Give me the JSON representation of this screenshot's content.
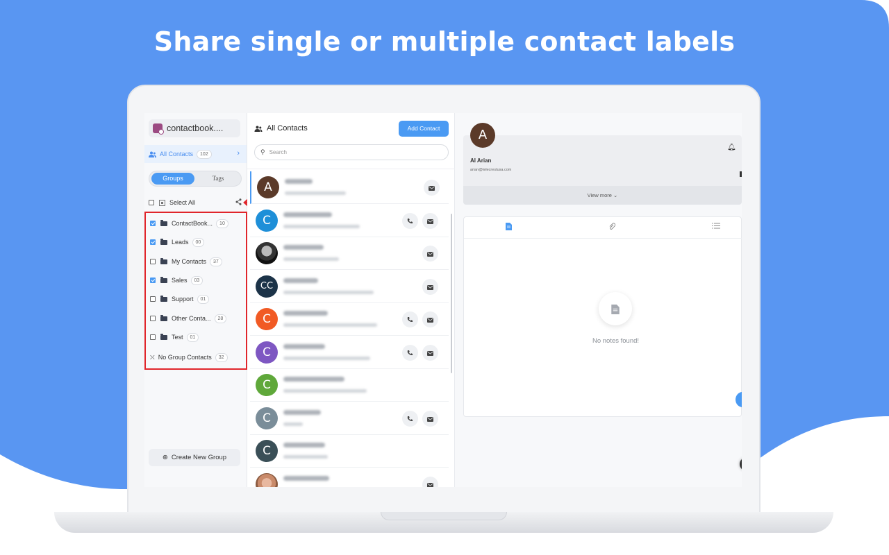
{
  "headline": "Share single or multiple contact labels",
  "colors": {
    "background_blue": "#5996f2",
    "accent": "#4a9af3",
    "highlight_red": "#e0252b"
  },
  "sidebar": {
    "brand": "contactbook....",
    "all_contacts": {
      "label": "All Contacts",
      "count": "102"
    },
    "segments": {
      "groups": "Groups",
      "tags": "Tags"
    },
    "select_all": "Select All",
    "groups": [
      {
        "label": "ContactBook...",
        "count": "10",
        "checked": true
      },
      {
        "label": "Leads",
        "count": "00",
        "checked": true
      },
      {
        "label": "My Contacts",
        "count": "37",
        "checked": false
      },
      {
        "label": "Sales",
        "count": "03",
        "checked": true
      },
      {
        "label": "Support",
        "count": "01",
        "checked": false
      },
      {
        "label": "Other Conta...",
        "count": "28",
        "checked": false
      },
      {
        "label": "Test",
        "count": "01",
        "checked": false
      }
    ],
    "no_group": {
      "label": "No Group Contacts",
      "count": "32"
    },
    "create_group": "Create New Group"
  },
  "list": {
    "title": "All Contacts",
    "add_button": "Add Contact",
    "search_placeholder": "Search",
    "contacts": [
      {
        "initial": "A",
        "color": "#5b3a29",
        "phone": false,
        "mail": true
      },
      {
        "initial": "C",
        "color": "#1e8fd8",
        "phone": true,
        "mail": true
      },
      {
        "initial": "",
        "color": "photo",
        "phone": false,
        "mail": true
      },
      {
        "initial": "CC",
        "color": "#1c3348",
        "phone": false,
        "mail": true
      },
      {
        "initial": "C",
        "color": "#f15a24",
        "phone": true,
        "mail": true
      },
      {
        "initial": "C",
        "color": "#7e57c2",
        "phone": true,
        "mail": true
      },
      {
        "initial": "C",
        "color": "#5fa83a",
        "phone": false,
        "mail": false
      },
      {
        "initial": "C",
        "color": "#7a8d99",
        "phone": true,
        "mail": true
      },
      {
        "initial": "C",
        "color": "#3a4f57",
        "phone": false,
        "mail": false
      },
      {
        "initial": "",
        "color": "photo2",
        "phone": false,
        "mail": true
      }
    ]
  },
  "detail": {
    "avatar_initial": "A",
    "name": "Al Arian",
    "email": "arian@telecrestusa.com",
    "view_more": "View more",
    "empty_text": "No notes found!"
  }
}
